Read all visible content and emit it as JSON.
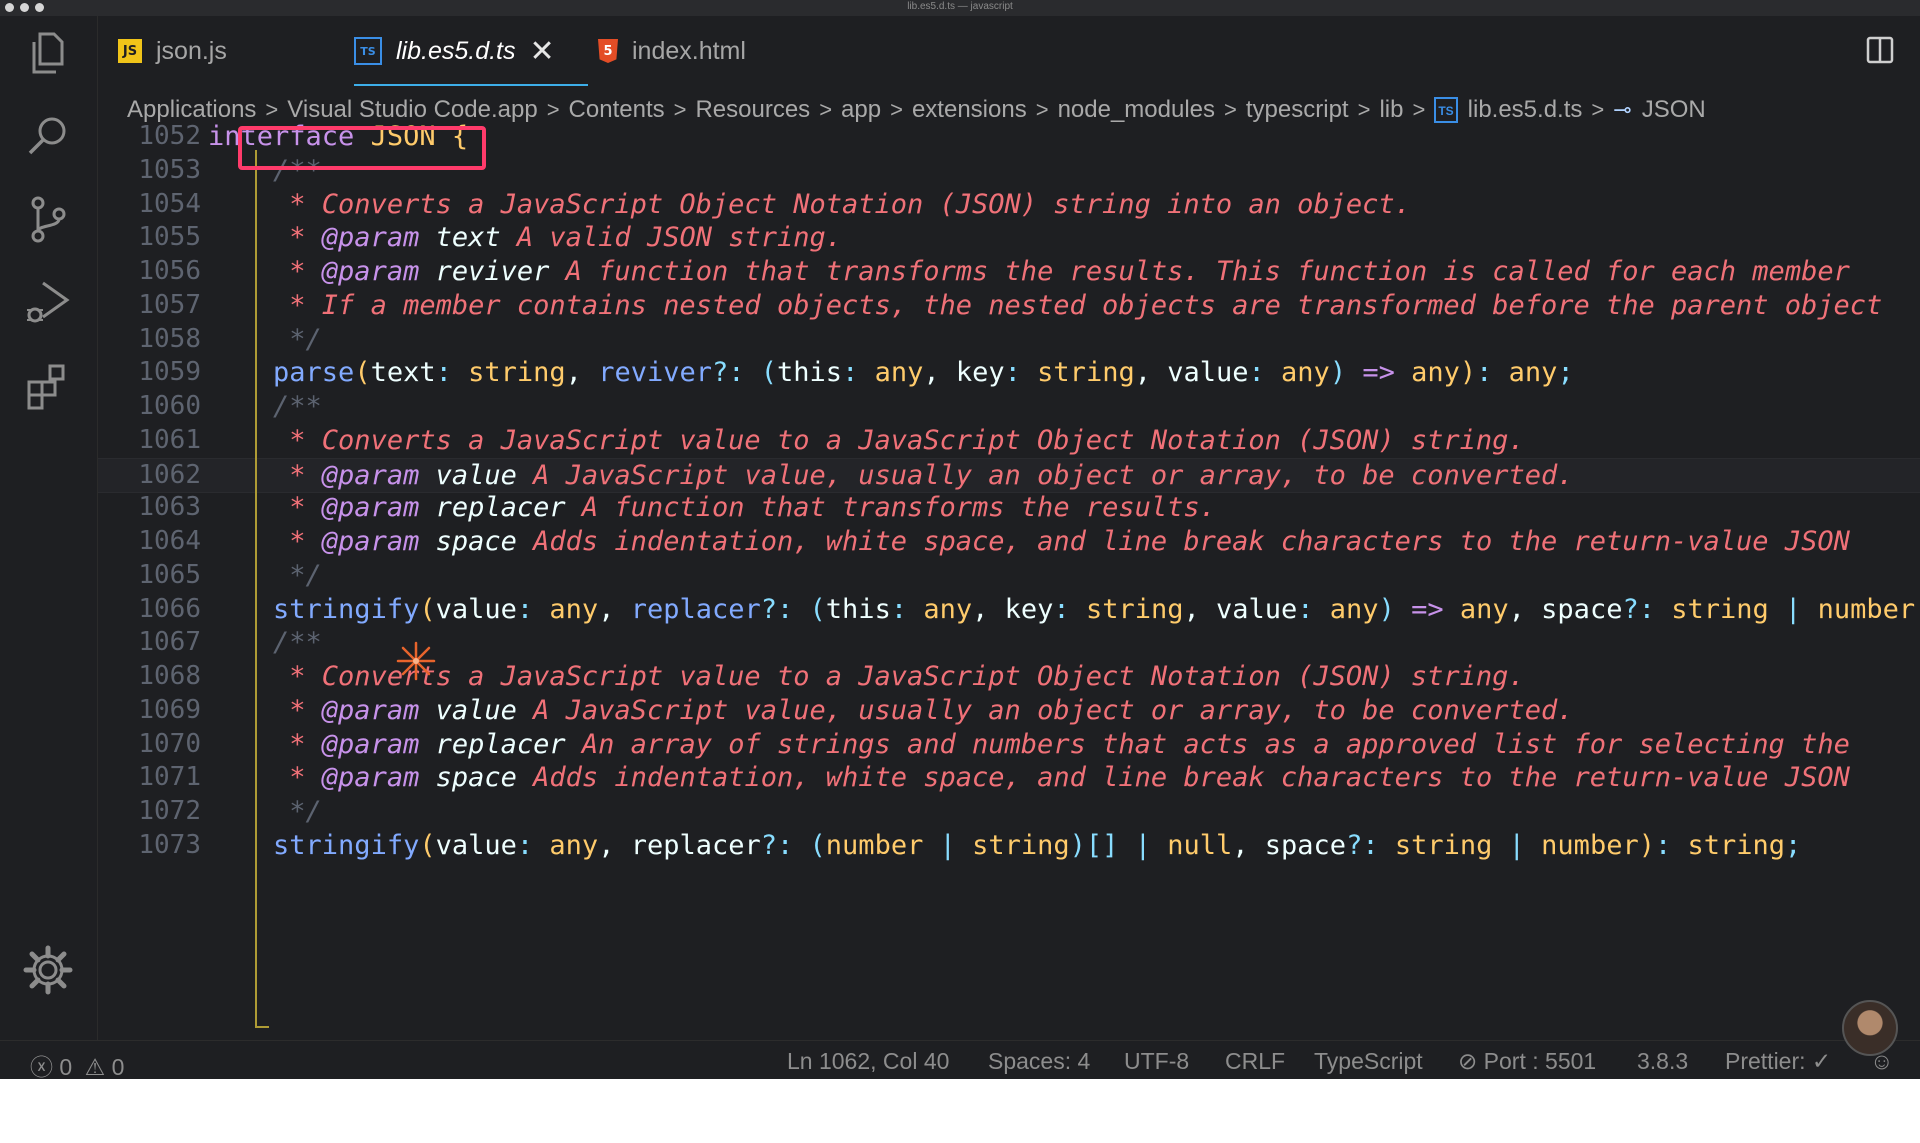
{
  "window": {
    "title": "lib.es5.d.ts — javascript"
  },
  "activity_bar": {
    "items": [
      {
        "icon": "files-icon"
      },
      {
        "icon": "search-icon"
      },
      {
        "icon": "source-control-icon"
      },
      {
        "icon": "run-debug-icon"
      },
      {
        "icon": "extensions-icon"
      },
      {
        "icon": "gear-icon"
      }
    ]
  },
  "tabs": [
    {
      "label": "json.js",
      "icon": "JS",
      "icon_color": "#f0c419",
      "active": false
    },
    {
      "label": "lib.es5.d.ts",
      "icon": "TS",
      "icon_color": "#3a8ee6",
      "active": true,
      "close": "✕"
    },
    {
      "label": "index.html",
      "icon": "5",
      "icon_color": "#e44d26",
      "active": false
    }
  ],
  "breadcrumbs": {
    "items": [
      "Applications",
      "Visual Studio Code.app",
      "Contents",
      "Resources",
      "app",
      "extensions",
      "node_modules",
      "typescript",
      "lib"
    ],
    "file": "lib.es5.d.ts",
    "file_icon": "TS",
    "symbol": "JSON",
    "symbol_icon": "⊸",
    "separator": ">"
  },
  "editor": {
    "current_line": 1062,
    "line_numbers": [
      "1052",
      "1053",
      "1054",
      "1055",
      "1056",
      "1057",
      "1058",
      "1059",
      "1060",
      "1061",
      "1062",
      "1063",
      "1064",
      "1065",
      "1066",
      "1067",
      "1068",
      "1069",
      "1070",
      "1071",
      "1072",
      "1073"
    ],
    "lines": [
      [
        {
          "t": "interface",
          "c": "kw"
        },
        {
          "t": " ",
          "c": "par"
        },
        {
          "t": "JSON",
          "c": "ent"
        },
        {
          "t": " ",
          "c": "par"
        },
        {
          "t": "{",
          "c": "brace"
        }
      ],
      [
        {
          "t": "    /**",
          "c": "cm"
        }
      ],
      [
        {
          "t": "     * ",
          "c": "doc"
        },
        {
          "t": "Converts a JavaScript Object Notation (JSON) string into an object.",
          "c": "doc"
        }
      ],
      [
        {
          "t": "     * ",
          "c": "doc"
        },
        {
          "t": "@param",
          "c": "tag"
        },
        {
          "t": " ",
          "c": "doc"
        },
        {
          "t": "text",
          "c": "pn"
        },
        {
          "t": " A valid JSON string.",
          "c": "doc"
        }
      ],
      [
        {
          "t": "     * ",
          "c": "doc"
        },
        {
          "t": "@param",
          "c": "tag"
        },
        {
          "t": " ",
          "c": "doc"
        },
        {
          "t": "reviver",
          "c": "pn"
        },
        {
          "t": " A function that transforms the results. This function is called for each member",
          "c": "doc"
        }
      ],
      [
        {
          "t": "     * ",
          "c": "doc"
        },
        {
          "t": "If a member contains nested objects, the nested objects are transformed before the parent object",
          "c": "doc"
        }
      ],
      [
        {
          "t": "     */",
          "c": "cm"
        }
      ],
      [
        {
          "t": "    ",
          "c": "par"
        },
        {
          "t": "parse",
          "c": "fn"
        },
        {
          "t": "(",
          "c": "ent"
        },
        {
          "t": "text",
          "c": "par"
        },
        {
          "t": ": ",
          "c": "punc"
        },
        {
          "t": "string",
          "c": "type"
        },
        {
          "t": ", ",
          "c": "par"
        },
        {
          "t": "reviver",
          "c": "fn"
        },
        {
          "t": "?: ",
          "c": "punc"
        },
        {
          "t": "(",
          "c": "punc"
        },
        {
          "t": "this",
          "c": "par"
        },
        {
          "t": ": ",
          "c": "punc"
        },
        {
          "t": "any",
          "c": "type"
        },
        {
          "t": ", ",
          "c": "par"
        },
        {
          "t": "key",
          "c": "par"
        },
        {
          "t": ": ",
          "c": "punc"
        },
        {
          "t": "string",
          "c": "type"
        },
        {
          "t": ", ",
          "c": "par"
        },
        {
          "t": "value",
          "c": "par"
        },
        {
          "t": ": ",
          "c": "punc"
        },
        {
          "t": "any",
          "c": "type"
        },
        {
          "t": ") ",
          "c": "punc"
        },
        {
          "t": "=>",
          "c": "kw"
        },
        {
          "t": " ",
          "c": "par"
        },
        {
          "t": "any",
          "c": "type"
        },
        {
          "t": ")",
          "c": "ent"
        },
        {
          "t": ": ",
          "c": "punc"
        },
        {
          "t": "any",
          "c": "type"
        },
        {
          "t": ";",
          "c": "punc"
        }
      ],
      [
        {
          "t": "    /**",
          "c": "cm"
        }
      ],
      [
        {
          "t": "     * ",
          "c": "doc"
        },
        {
          "t": "Converts a JavaScript value to a JavaScript Object Notation (JSON) string.",
          "c": "doc"
        }
      ],
      [
        {
          "t": "     * ",
          "c": "doc"
        },
        {
          "t": "@param",
          "c": "tag"
        },
        {
          "t": " ",
          "c": "doc"
        },
        {
          "t": "value",
          "c": "pn"
        },
        {
          "t": " A JavaScript value, usually an object or array, to be converted.",
          "c": "doc"
        }
      ],
      [
        {
          "t": "     * ",
          "c": "doc"
        },
        {
          "t": "@param",
          "c": "tag"
        },
        {
          "t": " ",
          "c": "doc"
        },
        {
          "t": "replacer",
          "c": "pn"
        },
        {
          "t": " A function that transforms the results.",
          "c": "doc"
        }
      ],
      [
        {
          "t": "     * ",
          "c": "doc"
        },
        {
          "t": "@param",
          "c": "tag"
        },
        {
          "t": " ",
          "c": "doc"
        },
        {
          "t": "space",
          "c": "pn"
        },
        {
          "t": " Adds indentation, white space, and line break characters to the return-value JSON",
          "c": "doc"
        }
      ],
      [
        {
          "t": "     */",
          "c": "cm"
        }
      ],
      [
        {
          "t": "    ",
          "c": "par"
        },
        {
          "t": "stringify",
          "c": "fn"
        },
        {
          "t": "(",
          "c": "ent"
        },
        {
          "t": "value",
          "c": "par"
        },
        {
          "t": ": ",
          "c": "punc"
        },
        {
          "t": "any",
          "c": "type"
        },
        {
          "t": ", ",
          "c": "par"
        },
        {
          "t": "replacer",
          "c": "fn"
        },
        {
          "t": "?: ",
          "c": "punc"
        },
        {
          "t": "(",
          "c": "punc"
        },
        {
          "t": "this",
          "c": "par"
        },
        {
          "t": ": ",
          "c": "punc"
        },
        {
          "t": "any",
          "c": "type"
        },
        {
          "t": ", ",
          "c": "par"
        },
        {
          "t": "key",
          "c": "par"
        },
        {
          "t": ": ",
          "c": "punc"
        },
        {
          "t": "string",
          "c": "type"
        },
        {
          "t": ", ",
          "c": "par"
        },
        {
          "t": "value",
          "c": "par"
        },
        {
          "t": ": ",
          "c": "punc"
        },
        {
          "t": "any",
          "c": "type"
        },
        {
          "t": ") ",
          "c": "punc"
        },
        {
          "t": "=>",
          "c": "kw"
        },
        {
          "t": " ",
          "c": "par"
        },
        {
          "t": "any",
          "c": "type"
        },
        {
          "t": ", ",
          "c": "par"
        },
        {
          "t": "space",
          "c": "par"
        },
        {
          "t": "?: ",
          "c": "punc"
        },
        {
          "t": "string",
          "c": "type"
        },
        {
          "t": " | ",
          "c": "punc"
        },
        {
          "t": "number",
          "c": "type"
        }
      ],
      [
        {
          "t": "    /**",
          "c": "cm"
        }
      ],
      [
        {
          "t": "     * ",
          "c": "doc"
        },
        {
          "t": "Converts a JavaScript value to a JavaScript Object Notation (JSON) string.",
          "c": "doc"
        }
      ],
      [
        {
          "t": "     * ",
          "c": "doc"
        },
        {
          "t": "@param",
          "c": "tag"
        },
        {
          "t": " ",
          "c": "doc"
        },
        {
          "t": "value",
          "c": "pn"
        },
        {
          "t": " A JavaScript value, usually an object or array, to be converted.",
          "c": "doc"
        }
      ],
      [
        {
          "t": "     * ",
          "c": "doc"
        },
        {
          "t": "@param",
          "c": "tag"
        },
        {
          "t": " ",
          "c": "doc"
        },
        {
          "t": "replacer",
          "c": "pn"
        },
        {
          "t": " An array of strings and numbers that acts as a approved list for selecting the",
          "c": "doc"
        }
      ],
      [
        {
          "t": "     * ",
          "c": "doc"
        },
        {
          "t": "@param",
          "c": "tag"
        },
        {
          "t": " ",
          "c": "doc"
        },
        {
          "t": "space",
          "c": "pn"
        },
        {
          "t": " Adds indentation, white space, and line break characters to the return-value JSON",
          "c": "doc"
        }
      ],
      [
        {
          "t": "     */",
          "c": "cm"
        }
      ],
      [
        {
          "t": "    ",
          "c": "par"
        },
        {
          "t": "stringify",
          "c": "fn"
        },
        {
          "t": "(",
          "c": "ent"
        },
        {
          "t": "value",
          "c": "par"
        },
        {
          "t": ": ",
          "c": "punc"
        },
        {
          "t": "any",
          "c": "type"
        },
        {
          "t": ", ",
          "c": "par"
        },
        {
          "t": "replacer",
          "c": "par"
        },
        {
          "t": "?: ",
          "c": "punc"
        },
        {
          "t": "(",
          "c": "punc"
        },
        {
          "t": "number",
          "c": "type"
        },
        {
          "t": " | ",
          "c": "punc"
        },
        {
          "t": "string",
          "c": "type"
        },
        {
          "t": ")[]",
          "c": "punc"
        },
        {
          "t": " | ",
          "c": "punc"
        },
        {
          "t": "null",
          "c": "type"
        },
        {
          "t": ", ",
          "c": "par"
        },
        {
          "t": "space",
          "c": "par"
        },
        {
          "t": "?: ",
          "c": "punc"
        },
        {
          "t": "string",
          "c": "type"
        },
        {
          "t": " | ",
          "c": "punc"
        },
        {
          "t": "number",
          "c": "type"
        },
        {
          "t": ")",
          "c": "ent"
        },
        {
          "t": ": ",
          "c": "punc"
        },
        {
          "t": "string",
          "c": "type"
        },
        {
          "t": ";",
          "c": "punc"
        }
      ]
    ]
  },
  "status_bar": {
    "errors": "0",
    "warnings": "0",
    "position": "Ln 1062, Col 40",
    "spaces": "Spaces: 4",
    "encoding": "UTF-8",
    "eol": "CRLF",
    "language": "TypeScript",
    "port": "Port : 5501",
    "version": "3.8.3",
    "prettier": "Prettier: ✓"
  },
  "colors": {
    "accent": "#3daee9",
    "highlight_box": "#ff3b6b",
    "indent_guide": "#ae9b35"
  }
}
